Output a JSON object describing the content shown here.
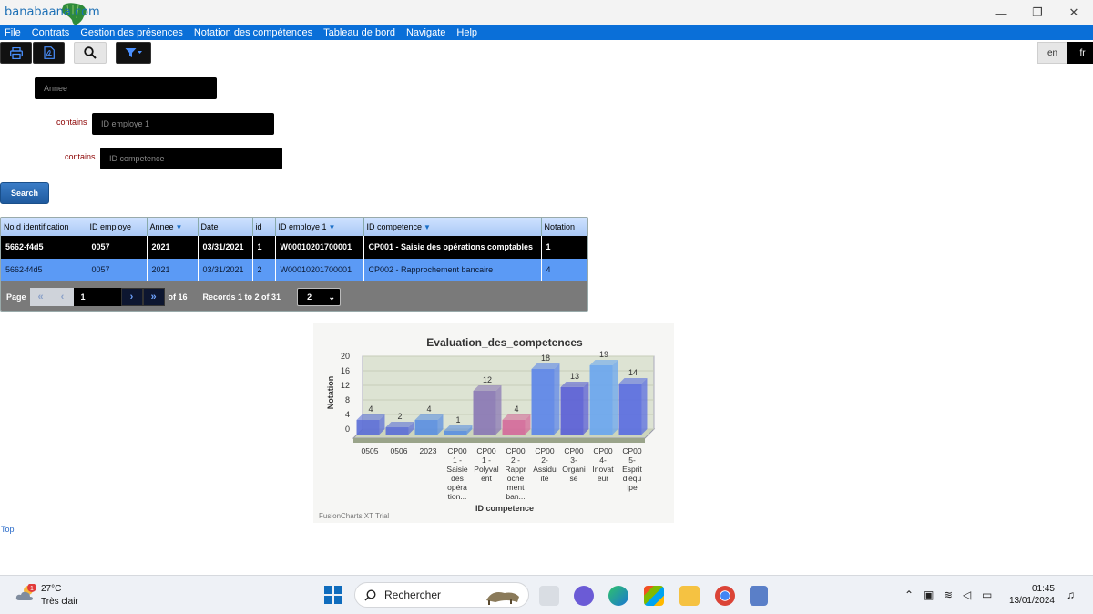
{
  "app": {
    "logo_text": "banabaana.com"
  },
  "window_controls": {
    "minimize": "—",
    "maximize": "❐",
    "close": "✕"
  },
  "menu": [
    {
      "label": "File"
    },
    {
      "label": "Contrats"
    },
    {
      "label": "Gestion des présences"
    },
    {
      "label": "Notation des compétences"
    },
    {
      "label": "Tableau de bord"
    },
    {
      "label": "Navigate"
    },
    {
      "label": "Help"
    }
  ],
  "toolbar": {
    "icons": [
      "print-icon",
      "pdf-icon",
      "search-icon",
      "filter-icon"
    ],
    "lang_en": "en",
    "lang_fr": "fr"
  },
  "filters": {
    "annee_placeholder": "Annee",
    "contains_1": "contains",
    "id_employe_placeholder": "ID employe 1",
    "contains_2": "contains",
    "id_competence_placeholder": "ID competence",
    "search_label": "Search"
  },
  "grid": {
    "columns": [
      "No d identification",
      "ID employe",
      "Annee",
      "Date",
      "id",
      "ID employe 1",
      "ID competence",
      "Notation"
    ],
    "filter_columns": [
      2,
      5,
      6
    ],
    "rows": [
      [
        "5662-f4d5",
        "0057",
        "2021",
        "03/31/2021",
        "1",
        "W00010201700001",
        "CP001 - Saisie des opérations comptables",
        "1"
      ],
      [
        "5662-f4d5",
        "0057",
        "2021",
        "03/31/2021",
        "2",
        "W00010201700001",
        "CP002 - Rapprochement bancaire",
        "4"
      ]
    ],
    "pager": {
      "page_label": "Page",
      "current_page": "1",
      "of_label": "of 16",
      "records_label": "Records 1 to 2 of 31",
      "page_size": "2"
    }
  },
  "chart_data": {
    "type": "bar",
    "title": "Evaluation_des_competences",
    "xlabel": "ID competence",
    "ylabel": "Notation",
    "ylim": [
      0,
      20
    ],
    "yticks": [
      0,
      4,
      8,
      12,
      16,
      20
    ],
    "categories": [
      "0505",
      "0506",
      "2023",
      "CP001 - Saisie des opération...",
      "CP001 - Polyvalent",
      "CP002 - Rapprochement ban...",
      "CP002 - Assiduité",
      "CP003 - Organisé",
      "CP004 - Innovateur",
      "CP005 - Esprit d'équipe"
    ],
    "category_lines": [
      [
        "0505"
      ],
      [
        "0506"
      ],
      [
        "2023"
      ],
      [
        "CP00",
        "1 -",
        "Saisie",
        "des",
        "opéra",
        "tion..."
      ],
      [
        "CP00",
        "1 -",
        "Polyval",
        "ent"
      ],
      [
        "CP00",
        "2 -",
        "Rappr",
        "oche",
        "ment",
        "ban..."
      ],
      [
        "CP00",
        "2-",
        "Assidu",
        "ité"
      ],
      [
        "CP00",
        "3-",
        "Organi",
        "sé"
      ],
      [
        "CP00",
        "4-",
        "Inovat",
        "eur"
      ],
      [
        "CP00",
        "5-",
        "Esprit",
        "d'équ",
        "ipe"
      ]
    ],
    "values": [
      4,
      2,
      4,
      1,
      12,
      4,
      18,
      13,
      19,
      14
    ],
    "colors": [
      "#5c6fd6",
      "#5c6fd6",
      "#5b8fe0",
      "#5b8fe0",
      "#8a78b4",
      "#d46a9a",
      "#5c86e8",
      "#5a5fd6",
      "#6aa6ee",
      "#5a6ee0"
    ],
    "watermark": "FusionCharts XT Trial"
  },
  "footer": {
    "top_link": "Top"
  },
  "taskbar": {
    "weather_temp": "27°C",
    "weather_desc": "Très clair",
    "weather_badge": "1",
    "search_placeholder": "Rechercher",
    "time": "01:45",
    "date": "13/01/2024"
  }
}
